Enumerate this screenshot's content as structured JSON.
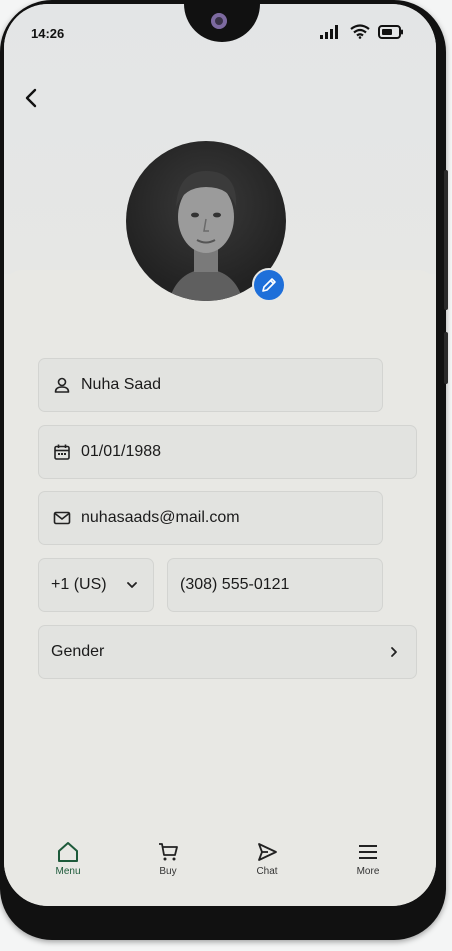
{
  "status_bar": {
    "time": "14:26"
  },
  "form": {
    "name": "Nuha Saad",
    "dob": "01/01/1988",
    "email": "nuhasaads@mail.com",
    "country_code": "+1 (US)",
    "phone": "(308) 555-0121",
    "gender_label": "Gender"
  },
  "nav": {
    "items": [
      {
        "label": "Menu",
        "icon": "home-icon",
        "active": true
      },
      {
        "label": "Buy",
        "icon": "cart-icon",
        "active": false
      },
      {
        "label": "Chat",
        "icon": "send-icon",
        "active": false
      },
      {
        "label": "More",
        "icon": "menu-icon",
        "active": false
      }
    ]
  },
  "colors": {
    "accent": "#1e6fd9",
    "active_nav": "#1d5a3a",
    "field_bg": "#e2e3e0"
  }
}
